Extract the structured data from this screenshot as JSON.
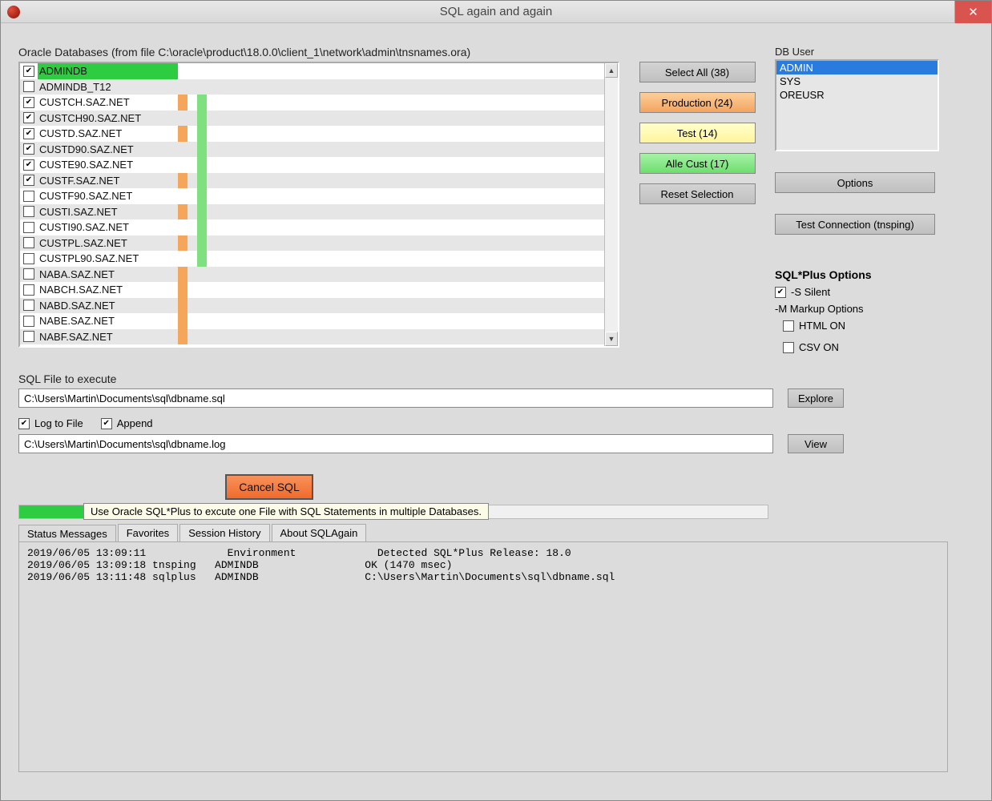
{
  "window": {
    "title": "SQL again and again"
  },
  "db_panel": {
    "label": "Oracle Databases (from file C:\\oracle\\product\\18.0.0\\client_1\\network\\admin\\tnsnames.ora)",
    "items": [
      {
        "name": "ADMINDB",
        "checked": true,
        "highlight": true,
        "orange": false,
        "green": false
      },
      {
        "name": "ADMINDB_T12",
        "checked": false,
        "highlight": false,
        "orange": false,
        "green": false
      },
      {
        "name": "CUSTCH.SAZ.NET",
        "checked": true,
        "highlight": false,
        "orange": true,
        "green": true
      },
      {
        "name": "CUSTCH90.SAZ.NET",
        "checked": true,
        "highlight": false,
        "orange": false,
        "green": true
      },
      {
        "name": "CUSTD.SAZ.NET",
        "checked": true,
        "highlight": false,
        "orange": true,
        "green": true
      },
      {
        "name": "CUSTD90.SAZ.NET",
        "checked": true,
        "highlight": false,
        "orange": false,
        "green": true
      },
      {
        "name": "CUSTE90.SAZ.NET",
        "checked": true,
        "highlight": false,
        "orange": false,
        "green": true
      },
      {
        "name": "CUSTF.SAZ.NET",
        "checked": true,
        "highlight": false,
        "orange": true,
        "green": true
      },
      {
        "name": "CUSTF90.SAZ.NET",
        "checked": false,
        "highlight": false,
        "orange": false,
        "green": true
      },
      {
        "name": "CUSTI.SAZ.NET",
        "checked": false,
        "highlight": false,
        "orange": true,
        "green": true
      },
      {
        "name": "CUSTI90.SAZ.NET",
        "checked": false,
        "highlight": false,
        "orange": false,
        "green": true
      },
      {
        "name": "CUSTPL.SAZ.NET",
        "checked": false,
        "highlight": false,
        "orange": true,
        "green": true
      },
      {
        "name": "CUSTPL90.SAZ.NET",
        "checked": false,
        "highlight": false,
        "orange": false,
        "green": true
      },
      {
        "name": "NABA.SAZ.NET",
        "checked": false,
        "highlight": false,
        "orange": true,
        "green": false
      },
      {
        "name": "NABCH.SAZ.NET",
        "checked": false,
        "highlight": false,
        "orange": true,
        "green": false
      },
      {
        "name": "NABD.SAZ.NET",
        "checked": false,
        "highlight": false,
        "orange": true,
        "green": false
      },
      {
        "name": "NABE.SAZ.NET",
        "checked": false,
        "highlight": false,
        "orange": true,
        "green": false
      },
      {
        "name": "NABF.SAZ.NET",
        "checked": false,
        "highlight": false,
        "orange": true,
        "green": false
      }
    ]
  },
  "buttons": {
    "select_all": "Select All (38)",
    "production": "Production (24)",
    "test": "Test (14)",
    "alle_cust": "Alle Cust (17)",
    "reset": "Reset Selection",
    "options": "Options",
    "test_conn": "Test Connection (tnsping)",
    "explore": "Explore",
    "view": "View",
    "cancel": "Cancel SQL"
  },
  "db_user": {
    "label": "DB User",
    "items": [
      {
        "name": "ADMIN",
        "selected": true
      },
      {
        "name": "SYS",
        "selected": false
      },
      {
        "name": "OREUSR",
        "selected": false
      }
    ]
  },
  "sqlplus": {
    "header": "SQL*Plus Options",
    "silent": "-S Silent",
    "markup": "-M Markup Options",
    "html_on": "HTML ON",
    "csv_on": "CSV ON"
  },
  "sql_file": {
    "label": "SQL File to execute",
    "value": "C:\\Users\\Martin\\Documents\\sql\\dbname.sql"
  },
  "log_opts": {
    "log_to_file": "Log to File",
    "append": "Append",
    "value": "C:\\Users\\Martin\\Documents\\sql\\dbname.log"
  },
  "tooltip": "Use Oracle SQL*Plus to excute one File with SQL Statements in multiple Databases.",
  "tabs": {
    "status": "Status Messages",
    "favorites": "Favorites",
    "session": "Session History",
    "about": "About SQLAgain"
  },
  "log_lines": [
    "2019/06/05 13:09:11             Environment             Detected SQL*Plus Release: 18.0",
    "2019/06/05 13:09:18 tnsping   ADMINDB                 OK (1470 msec)",
    "2019/06/05 13:11:48 sqlplus   ADMINDB                 C:\\Users\\Martin\\Documents\\sql\\dbname.sql"
  ]
}
